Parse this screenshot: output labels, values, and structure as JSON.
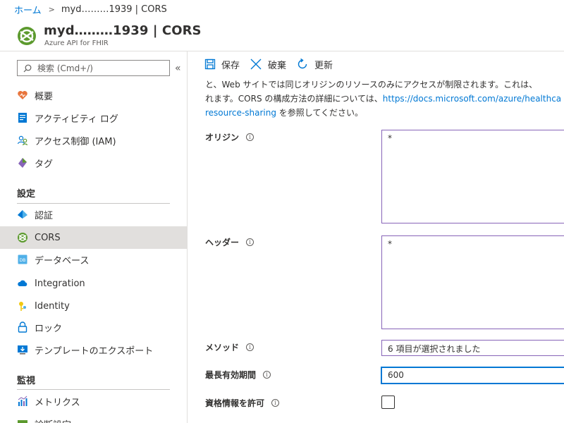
{
  "breadcrumb": {
    "home": "ホーム",
    "current": "myd………1939 | CORS"
  },
  "header": {
    "title": "myd………1939 | CORS",
    "subtitle": "Azure API for FHIR"
  },
  "sidebar": {
    "search_placeholder": "検索 (Cmd+/)",
    "collapse": "«",
    "items": [
      {
        "label": "概要",
        "icon": "heart-icon"
      },
      {
        "label": "アクティビティ ログ",
        "icon": "activity-log-icon"
      },
      {
        "label": "アクセス制御 (IAM)",
        "icon": "people-icon"
      },
      {
        "label": "タグ",
        "icon": "tag-icon"
      }
    ],
    "section_settings": "設定",
    "settings_items": [
      {
        "label": "認証",
        "icon": "auth-icon"
      },
      {
        "label": "CORS",
        "icon": "cors-icon"
      },
      {
        "label": "データベース",
        "icon": "database-icon"
      },
      {
        "label": "Integration",
        "icon": "cloud-icon"
      },
      {
        "label": "Identity",
        "icon": "key-icon"
      },
      {
        "label": "ロック",
        "icon": "lock-icon"
      },
      {
        "label": "テンプレートのエクスポート",
        "icon": "export-icon"
      }
    ],
    "section_monitoring": "監視",
    "monitoring_items": [
      {
        "label": "メトリクス",
        "icon": "metrics-icon"
      },
      {
        "label": "診断設定",
        "icon": "diagnostics-icon"
      }
    ]
  },
  "toolbar": {
    "save": "保存",
    "discard": "破棄",
    "refresh": "更新"
  },
  "description": {
    "line1": "と、Web サイトでは同じオリジンのリソースのみにアクセスが制限されます。これは、",
    "line2_text": "れます。CORS の構成方法の詳細については、",
    "link_part1": "https://docs.microsoft.com/azure/healthca",
    "link_part2": "resource-sharing",
    "line3_text": " を参照してください。"
  },
  "form": {
    "origins_label": "オリジン",
    "origins_value": "*",
    "headers_label": "ヘッダー",
    "headers_value": "*",
    "methods_label": "メソッド",
    "methods_value": "6 項目が選択されました",
    "maxage_label": "最長有効期間",
    "maxage_value": "600",
    "credentials_label": "資格情報を許可",
    "info_glyph": "i"
  },
  "colors": {
    "accent": "#0078d4",
    "field_border": "#8764b8",
    "active_nav": "#e1dfdd"
  }
}
